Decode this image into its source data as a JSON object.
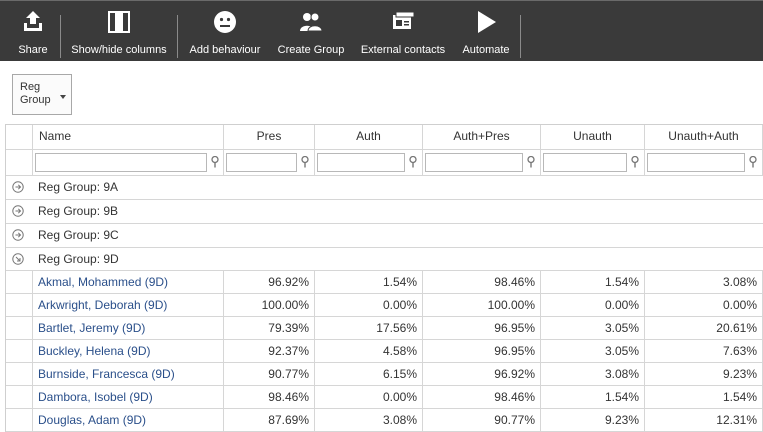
{
  "toolbar": {
    "buttons": [
      {
        "label": "Share",
        "icon": "share-icon"
      },
      {
        "label": "Show/hide columns",
        "icon": "columns-icon"
      },
      {
        "label": "Add behaviour",
        "icon": "smiley-icon"
      },
      {
        "label": "Create Group",
        "icon": "group-icon"
      },
      {
        "label": "External contacts",
        "icon": "contacts-card-icon"
      },
      {
        "label": "Automate",
        "icon": "play-icon"
      }
    ]
  },
  "grouping": {
    "label": "Reg Group"
  },
  "columns": [
    "Name",
    "Pres",
    "Auth",
    "Auth+Pres",
    "Unauth",
    "Unauth+Auth"
  ],
  "groups": [
    {
      "label": "Reg Group: 9A",
      "expanded": false
    },
    {
      "label": "Reg Group: 9B",
      "expanded": false
    },
    {
      "label": "Reg Group: 9C",
      "expanded": false
    },
    {
      "label": "Reg Group: 9D",
      "expanded": true
    }
  ],
  "rows": [
    {
      "name": "Akmal, Mohammed (9D)",
      "pres": "96.92%",
      "auth": "1.54%",
      "auth_pres": "98.46%",
      "unauth": "1.54%",
      "unauth_auth": "3.08%"
    },
    {
      "name": "Arkwright, Deborah (9D)",
      "pres": "100.00%",
      "auth": "0.00%",
      "auth_pres": "100.00%",
      "unauth": "0.00%",
      "unauth_auth": "0.00%"
    },
    {
      "name": "Bartlet, Jeremy (9D)",
      "pres": "79.39%",
      "auth": "17.56%",
      "auth_pres": "96.95%",
      "unauth": "3.05%",
      "unauth_auth": "20.61%"
    },
    {
      "name": "Buckley, Helena (9D)",
      "pres": "92.37%",
      "auth": "4.58%",
      "auth_pres": "96.95%",
      "unauth": "3.05%",
      "unauth_auth": "7.63%"
    },
    {
      "name": "Burnside, Francesca (9D)",
      "pres": "90.77%",
      "auth": "6.15%",
      "auth_pres": "96.92%",
      "unauth": "3.08%",
      "unauth_auth": "9.23%"
    },
    {
      "name": "Dambora, Isobel (9D)",
      "pres": "98.46%",
      "auth": "0.00%",
      "auth_pres": "98.46%",
      "unauth": "1.54%",
      "unauth_auth": "1.54%"
    },
    {
      "name": "Douglas, Adam (9D)",
      "pres": "87.69%",
      "auth": "3.08%",
      "auth_pres": "90.77%",
      "unauth": "9.23%",
      "unauth_auth": "12.31%"
    }
  ]
}
